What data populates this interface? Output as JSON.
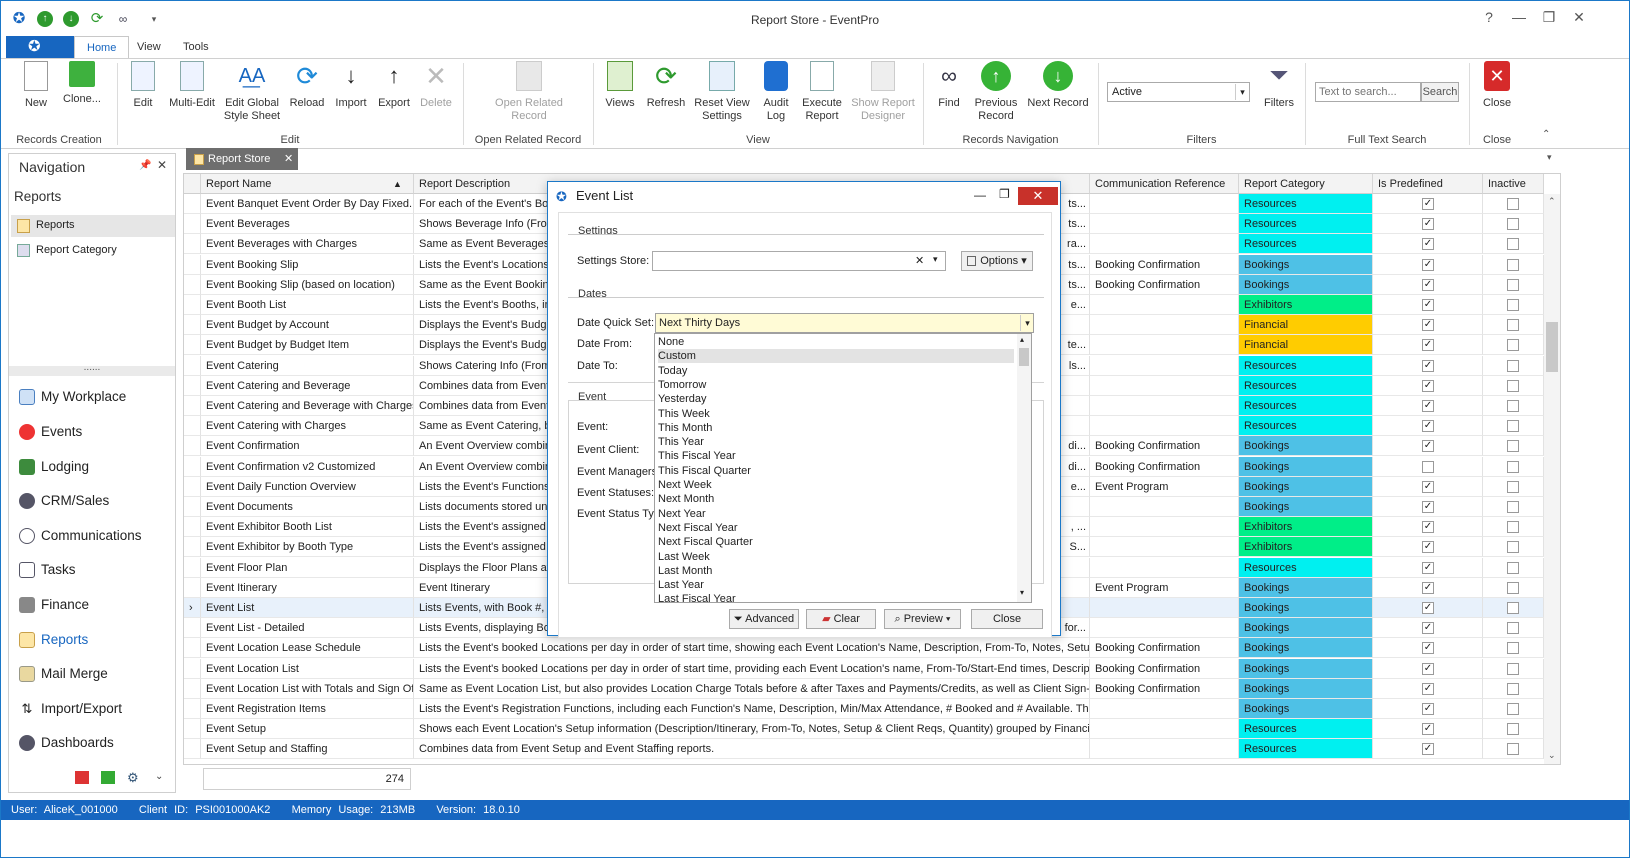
{
  "window": {
    "title": "Report Store - EventPro"
  },
  "ribbon_tabs": [
    "Home",
    "View",
    "Tools"
  ],
  "ribbon": {
    "new": "New",
    "clone": "Clone...",
    "edit": "Edit",
    "multi_edit": "Multi-Edit",
    "edit_global_style": "Edit Global\nStyle Sheet",
    "reload": "Reload",
    "import": "Import",
    "export": "Export",
    "delete": "Delete",
    "open_related": "Open Related\nRecord",
    "views": "Views",
    "refresh": "Refresh",
    "reset_view": "Reset View\nSettings",
    "audit_log": "Audit\nLog",
    "execute_report": "Execute\nReport",
    "show_designer": "Show Report\nDesigner",
    "find": "Find",
    "previous_record": "Previous\nRecord",
    "next_record": "Next Record",
    "filter_value": "Active",
    "filters": "Filters",
    "search_placeholder": "Text to search...",
    "search_button": "Search",
    "close": "Close",
    "groups": {
      "records_creation": "Records Creation",
      "edit": "Edit",
      "open_related": "Open Related Record",
      "view": "View",
      "records_nav": "Records Navigation",
      "filters": "Filters",
      "full_text": "Full Text Search",
      "close": "Close"
    }
  },
  "nav": {
    "title": "Navigation",
    "section": "Reports",
    "sub_items": [
      "Reports",
      "Report Category"
    ],
    "grip": "......",
    "modules": [
      "My Workplace",
      "Events",
      "Lodging",
      "CRM/Sales",
      "Communications",
      "Tasks",
      "Finance",
      "Reports",
      "Mail Merge",
      "Import/Export",
      "Dashboards"
    ]
  },
  "doc_tab": "Report Store",
  "grid": {
    "columns": [
      "Report Name",
      "Report Description",
      "Communication Reference",
      "Report Category",
      "Is Predefined",
      "Inactive"
    ],
    "rows": [
      [
        "Event Banquet Event Order By Day Fixed...",
        "For each of the Event's Book",
        "ts...",
        "",
        "Resources",
        true
      ],
      [
        "Event Beverages",
        "Shows Beverage Info (From",
        "ts...",
        "",
        "Resources",
        true
      ],
      [
        "Event Beverages with Charges",
        "Same as Event Beverages, b",
        "ra...",
        "",
        "Resources",
        true
      ],
      [
        "Event Booking Slip",
        "Lists the Event's Locations w",
        "ts...",
        "Booking Confirmation",
        "Bookings",
        true
      ],
      [
        "Event Booking Slip (based on location)",
        "Same as the Event Booking",
        "ts...",
        "Booking Confirmation",
        "Bookings",
        true
      ],
      [
        "Event Booth List",
        "Lists the Event's Booths, incl",
        "e...",
        "",
        "Exhibitors",
        true
      ],
      [
        "Event Budget by Account",
        "Displays the Event's Budget",
        "",
        "",
        "Financial",
        true
      ],
      [
        "Event Budget by Budget Item",
        "Displays the Event's Budget",
        "te...",
        "",
        "Financial",
        true
      ],
      [
        "Event Catering",
        "Shows Catering Info (From-",
        "ls...",
        "",
        "Resources",
        true
      ],
      [
        "Event Catering and Beverage",
        "Combines data from Event C",
        "",
        "",
        "Resources",
        true
      ],
      [
        "Event Catering and Beverage with Charges",
        "Combines data from Event C",
        "",
        "",
        "Resources",
        true
      ],
      [
        "Event Catering with Charges",
        "Same as Event Catering, bu",
        "",
        "",
        "Resources",
        true
      ],
      [
        "Event Confirmation",
        "An Event Overview combinin",
        "di...",
        "Booking Confirmation",
        "Bookings",
        true
      ],
      [
        "Event Confirmation v2 Customized",
        "An Event Overview combinin",
        "di...",
        "Booking Confirmation",
        "Bookings",
        false
      ],
      [
        "Event Daily Function Overview",
        "Lists the Event's Functions b",
        "e...",
        "Event Program",
        "Bookings",
        true
      ],
      [
        "Event Documents",
        "Lists documents stored unde",
        "",
        "",
        "Bookings",
        true
      ],
      [
        "Event Exhibitor Booth List",
        "Lists the Event's assigned Bo",
        ", ...",
        "",
        "Exhibitors",
        true
      ],
      [
        "Event Exhibitor by Booth Type",
        "Lists the Event's assigned Bo",
        "S...",
        "",
        "Exhibitors",
        true
      ],
      [
        "Event Floor Plan",
        "Displays the Floor Plans atta",
        "",
        "",
        "Resources",
        true
      ],
      [
        "Event Itinerary",
        "Event Itinerary",
        "",
        "Event Program",
        "Bookings",
        true
      ],
      [
        "Event List",
        "Lists Events, with Book #, S",
        "",
        "",
        "Bookings",
        true
      ],
      [
        "Event List - Detailed",
        "Lists Events, displaying Book",
        "for...",
        "",
        "Bookings",
        true
      ],
      [
        "Event Location Lease Schedule",
        "Lists the Event's booked Locations per day in order of start time, showing each Event Location's Name, Description, From-To, Notes, Setup & Client Reqs, ... A...",
        "",
        "Booking Confirmation",
        "Bookings",
        true
      ],
      [
        "Event Location List",
        "Lists the Event's booked Locations per day in order of start time, providing each Event Location's name, From-To/Start-End times, Description,...",
        "",
        "Booking Confirmation",
        "Bookings",
        true
      ],
      [
        "Event Location List with Totals and Sign Off",
        "Same as Event Location List, but also provides Location Charge Totals before & after Taxes and Payments/Credits, as well as Client Sign-off.",
        "",
        "Booking Confirmation",
        "Bookings",
        true
      ],
      [
        "Event Registration Items",
        "Lists the Event's Registration Functions, including each Function's Name, Description, Min/Max Attendance, # Booked and # Available. Then lis...",
        "",
        "",
        "Bookings",
        true
      ],
      [
        "Event Setup",
        "Shows each Event Location's Setup information (Description/Itinerary, From-To, Notes, Setup & Client Reqs, Quantity) grouped by Financial S...",
        "",
        "",
        "Resources",
        true
      ],
      [
        "Event Setup and Staffing",
        "Combines data from Event Setup and Event Staffing reports.",
        "",
        "",
        "Resources",
        true
      ]
    ],
    "count": "274"
  },
  "category_colors": {
    "Resources": "#00f0f0",
    "Bookings": "#4ec1e6",
    "Exhibitors": "#00ee88",
    "Financial": "#ffcc00"
  },
  "dialog": {
    "title": "Event List",
    "settings_group": "Settings",
    "settings_store_label": "Settings Store:",
    "options_button": "Options",
    "dates_group": "Dates",
    "date_quick_set_label": "Date Quick Set:",
    "date_quick_set_value": "Next Thirty Days",
    "date_from_label": "Date From:",
    "date_to_label": "Date To:",
    "event_group": "Event",
    "event_label": "Event:",
    "event_client_label": "Event Client:",
    "event_managers_label": "Event Managers:",
    "event_statuses_label": "Event Statuses:",
    "event_status_type_label": "Event Status Typ",
    "dropdown_options": [
      "None",
      "Custom",
      "Today",
      "Tomorrow",
      "Yesterday",
      "This Week",
      "This Month",
      "This Year",
      "This Fiscal Year",
      "This Fiscal Quarter",
      "Next Week",
      "Next Month",
      "Next Year",
      "Next Fiscal Year",
      "Next Fiscal Quarter",
      "Last Week",
      "Last Month",
      "Last Year",
      "Last Fiscal Year"
    ],
    "highlighted_option": "Custom",
    "advanced_button": "Advanced",
    "clear_button": "Clear",
    "preview_button": "Preview",
    "close_button": "Close"
  },
  "status": {
    "user": "User: AliceK_001000",
    "client": "Client ID: PSI001000AK2",
    "memory": "Memory Usage: 213MB",
    "version": "Version: 18.0.10"
  }
}
